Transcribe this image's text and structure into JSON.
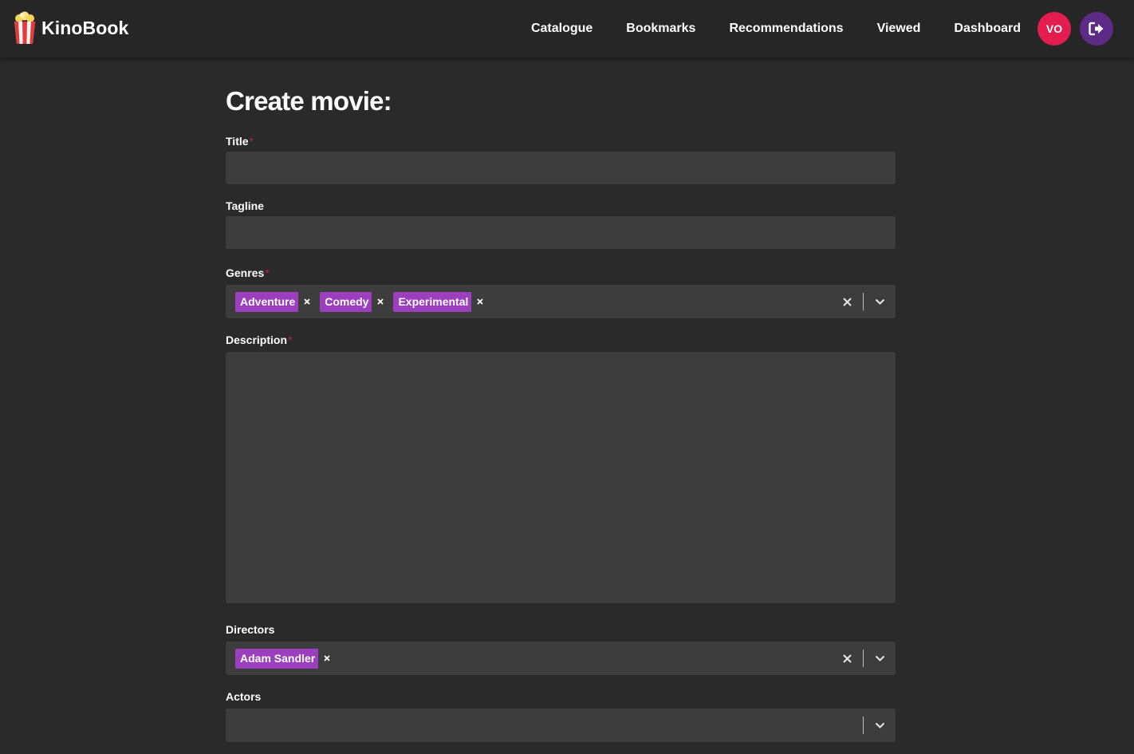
{
  "header": {
    "brand": "KinoBook",
    "nav": [
      "Catalogue",
      "Bookmarks",
      "Recommendations",
      "Viewed",
      "Dashboard"
    ],
    "avatar_initials": "VO"
  },
  "form": {
    "title": "Create movie:",
    "required_marker": "*",
    "fields": {
      "title": {
        "label": "Title",
        "value": ""
      },
      "tagline": {
        "label": "Tagline",
        "value": ""
      },
      "genres": {
        "label": "Genres",
        "selected": [
          "Adventure",
          "Comedy",
          "Experimental"
        ]
      },
      "description": {
        "label": "Description",
        "value": ""
      },
      "directors": {
        "label": "Directors",
        "selected": [
          "Adam Sandler"
        ]
      },
      "actors": {
        "label": "Actors",
        "selected": []
      }
    }
  },
  "colors": {
    "background": "#2a2a2a",
    "header": "#262626",
    "input": "#3d3d3d",
    "chip": "#9b3fbf",
    "avatar": "#e31d4d",
    "logout": "#5d2a86",
    "required": "#c0243a"
  },
  "icons": {
    "brand": "popcorn-icon",
    "logout": "logout-icon",
    "chip_remove": "close-icon",
    "clear": "clear-icon",
    "dropdown": "chevron-down-icon"
  }
}
